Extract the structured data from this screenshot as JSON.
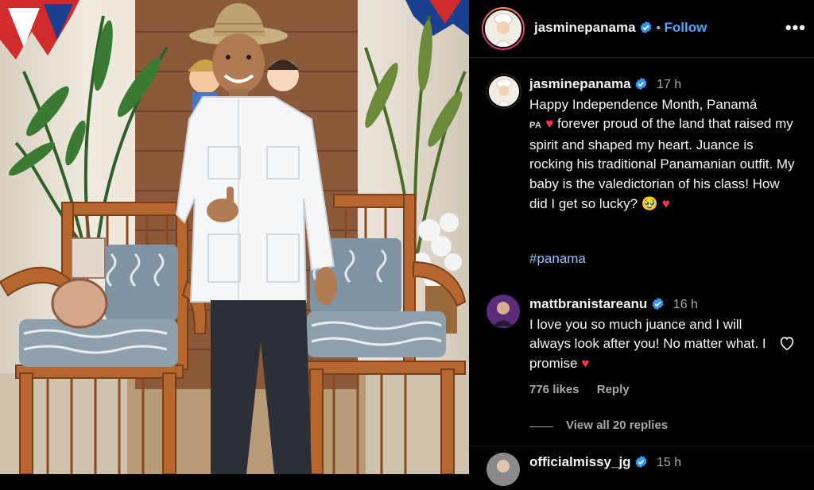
{
  "post": {
    "username": "jasminepanama",
    "follow_label": "Follow",
    "dot": "•",
    "more": "•••",
    "caption": {
      "time": "17 h",
      "line1": "Happy Independence Month, Panamá",
      "flag_code": "PA",
      "line2": "forever proud of the land that raised my spirit and shaped my heart. Juance is rocking his traditional Panamanian outfit. My baby is the valedictorian of his class! How did I get so lucky?",
      "emoji_tears": "🥹",
      "hashtag": "#panama"
    },
    "comments": [
      {
        "username": "mattbranistareanu",
        "time": "16 h",
        "text": "I love you so much juance and I will always look after you! No matter what. I promise",
        "likes": "776 likes",
        "reply_label": "Reply",
        "view_replies": "View all 20 replies"
      },
      {
        "username": "officialmissy_jg",
        "time": "15 h"
      }
    ]
  },
  "colors": {
    "background": "#000000",
    "link": "#4aa8ff",
    "hashtag": "#8ec1ff",
    "verified": "#3897f0",
    "heart": "#ff3355",
    "muted": "#a8a8a8"
  }
}
